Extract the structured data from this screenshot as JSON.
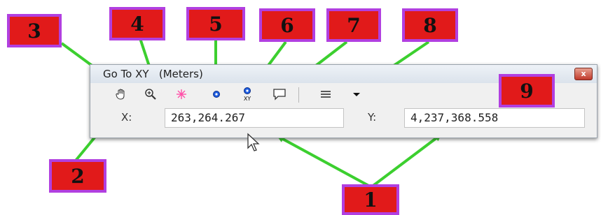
{
  "dialog": {
    "title": "Go To XY   (Meters)",
    "close_glyph": "x",
    "toolbar": {
      "buttons": [
        {
          "id": "pan",
          "icon": "hand-pan-icon"
        },
        {
          "id": "zoom",
          "icon": "zoom-in-icon"
        },
        {
          "id": "flash",
          "icon": "flash-location-icon"
        },
        {
          "id": "add-point",
          "icon": "add-point-icon"
        },
        {
          "id": "add-labeled-point",
          "icon": "add-labeled-point-icon",
          "caption": "XY"
        },
        {
          "id": "add-callout",
          "icon": "callout-icon"
        },
        {
          "id": "units-menu",
          "icon": "menu-lines-icon"
        },
        {
          "id": "recent-dropdown",
          "icon": "dropdown-arrow-icon"
        }
      ]
    },
    "x_label": "X:",
    "x_value": "263,264.267",
    "y_label": "Y:",
    "y_value": "4,237,368.558"
  },
  "callouts": [
    "1",
    "2",
    "3",
    "4",
    "5",
    "6",
    "7",
    "8",
    "9"
  ],
  "colors": {
    "callout_fill": "#e11a1a",
    "callout_border": "#b13fe0",
    "arrow": "#3ccf2f"
  }
}
